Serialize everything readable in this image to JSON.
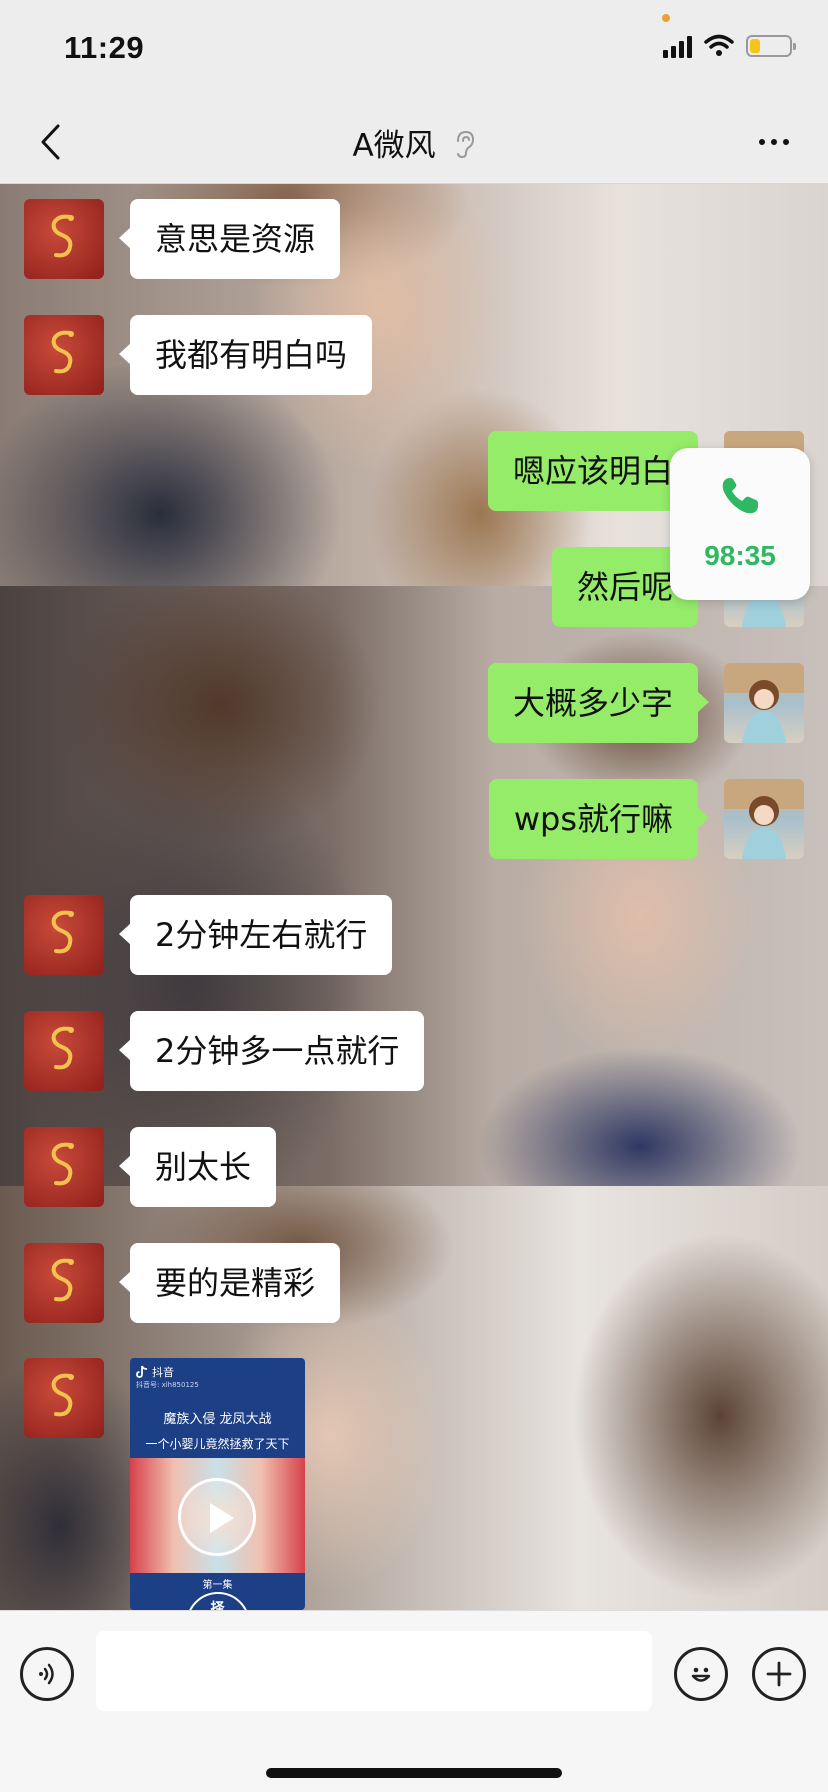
{
  "status_bar": {
    "time": "11:29",
    "battery_level": 0.25,
    "battery_color": "#f5c518"
  },
  "header": {
    "title": "A微风",
    "ear_icon": "ear-icon"
  },
  "colors": {
    "sent_bubble": "#95ec69",
    "received_bubble": "#ffffff",
    "call_green": "#2fb861"
  },
  "messages": [
    {
      "side": "left",
      "text": "意思是资源"
    },
    {
      "side": "left",
      "text": "我都有明白吗"
    },
    {
      "side": "right",
      "text": "嗯应该明白"
    },
    {
      "side": "right",
      "text": "然后呢"
    },
    {
      "side": "right",
      "text": "大概多少字"
    },
    {
      "side": "right",
      "text": "wps就行嘛"
    },
    {
      "side": "left",
      "text": "2分钟左右就行"
    },
    {
      "side": "left",
      "text": "2分钟多一点就行"
    },
    {
      "side": "left",
      "text": "别太长"
    },
    {
      "side": "left",
      "text": "要的是精彩"
    }
  ],
  "call_widget": {
    "duration": "98:35",
    "icon": "phone-icon"
  },
  "video_card": {
    "app_label": "抖音",
    "account": "抖音号: xlh850125",
    "line1": "魔族入侵 龙凤大战",
    "line2": "一个小婴儿竟然拯救了天下",
    "episode": "第一集",
    "badge_char": "择",
    "icon": "play-icon"
  },
  "input_bar": {
    "value": "",
    "icons": [
      "voice-icon",
      "emoji-icon",
      "plus-icon"
    ]
  }
}
